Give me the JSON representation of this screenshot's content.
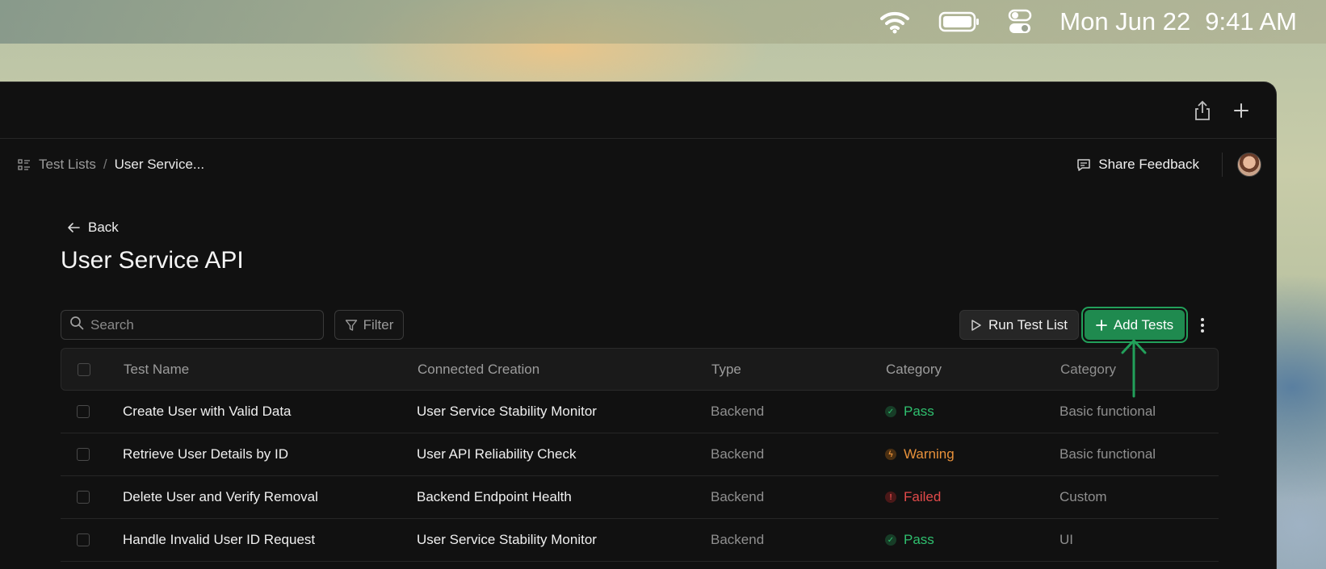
{
  "menubar": {
    "date": "Mon Jun 22",
    "time": "9:41 AM",
    "icons": [
      "wifi-icon",
      "battery-icon",
      "control-center-icon"
    ]
  },
  "window": {
    "titlebar_icons": [
      "share-icon",
      "plus-icon"
    ]
  },
  "breadcrumb": {
    "root": "Test Lists",
    "separator": "/",
    "current": "User Service..."
  },
  "header": {
    "feedback_label": "Share Feedback"
  },
  "page": {
    "back_label": "Back",
    "title": "User Service API"
  },
  "toolbar": {
    "search_placeholder": "Search",
    "filter_label": "Filter",
    "run_label": "Run Test List",
    "add_label": "Add Tests"
  },
  "table": {
    "columns": [
      "Test Name",
      "Connected Creation",
      "Type",
      "Category",
      "Category"
    ],
    "rows": [
      {
        "name": "Create User with Valid Data",
        "connected": "User Service Stability Monitor",
        "type": "Backend",
        "status": "Pass",
        "status_kind": "pass",
        "category": "Basic functional"
      },
      {
        "name": "Retrieve User Details by ID",
        "connected": "User API Reliability Check",
        "type": "Backend",
        "status": "Warning",
        "status_kind": "warn",
        "category": "Basic functional"
      },
      {
        "name": "Delete User and Verify Removal",
        "connected": "Backend Endpoint Health",
        "type": "Backend",
        "status": "Failed",
        "status_kind": "fail",
        "category": "Custom"
      },
      {
        "name": "Handle Invalid User ID Request",
        "connected": "User Service Stability Monitor",
        "type": "Backend",
        "status": "Pass",
        "status_kind": "pass",
        "category": "UI"
      }
    ]
  },
  "colors": {
    "accent": "#1f8a4f",
    "highlight": "#22a05a",
    "pass": "#2fbf6e",
    "warning": "#e8913a",
    "failed": "#e24a4a"
  }
}
